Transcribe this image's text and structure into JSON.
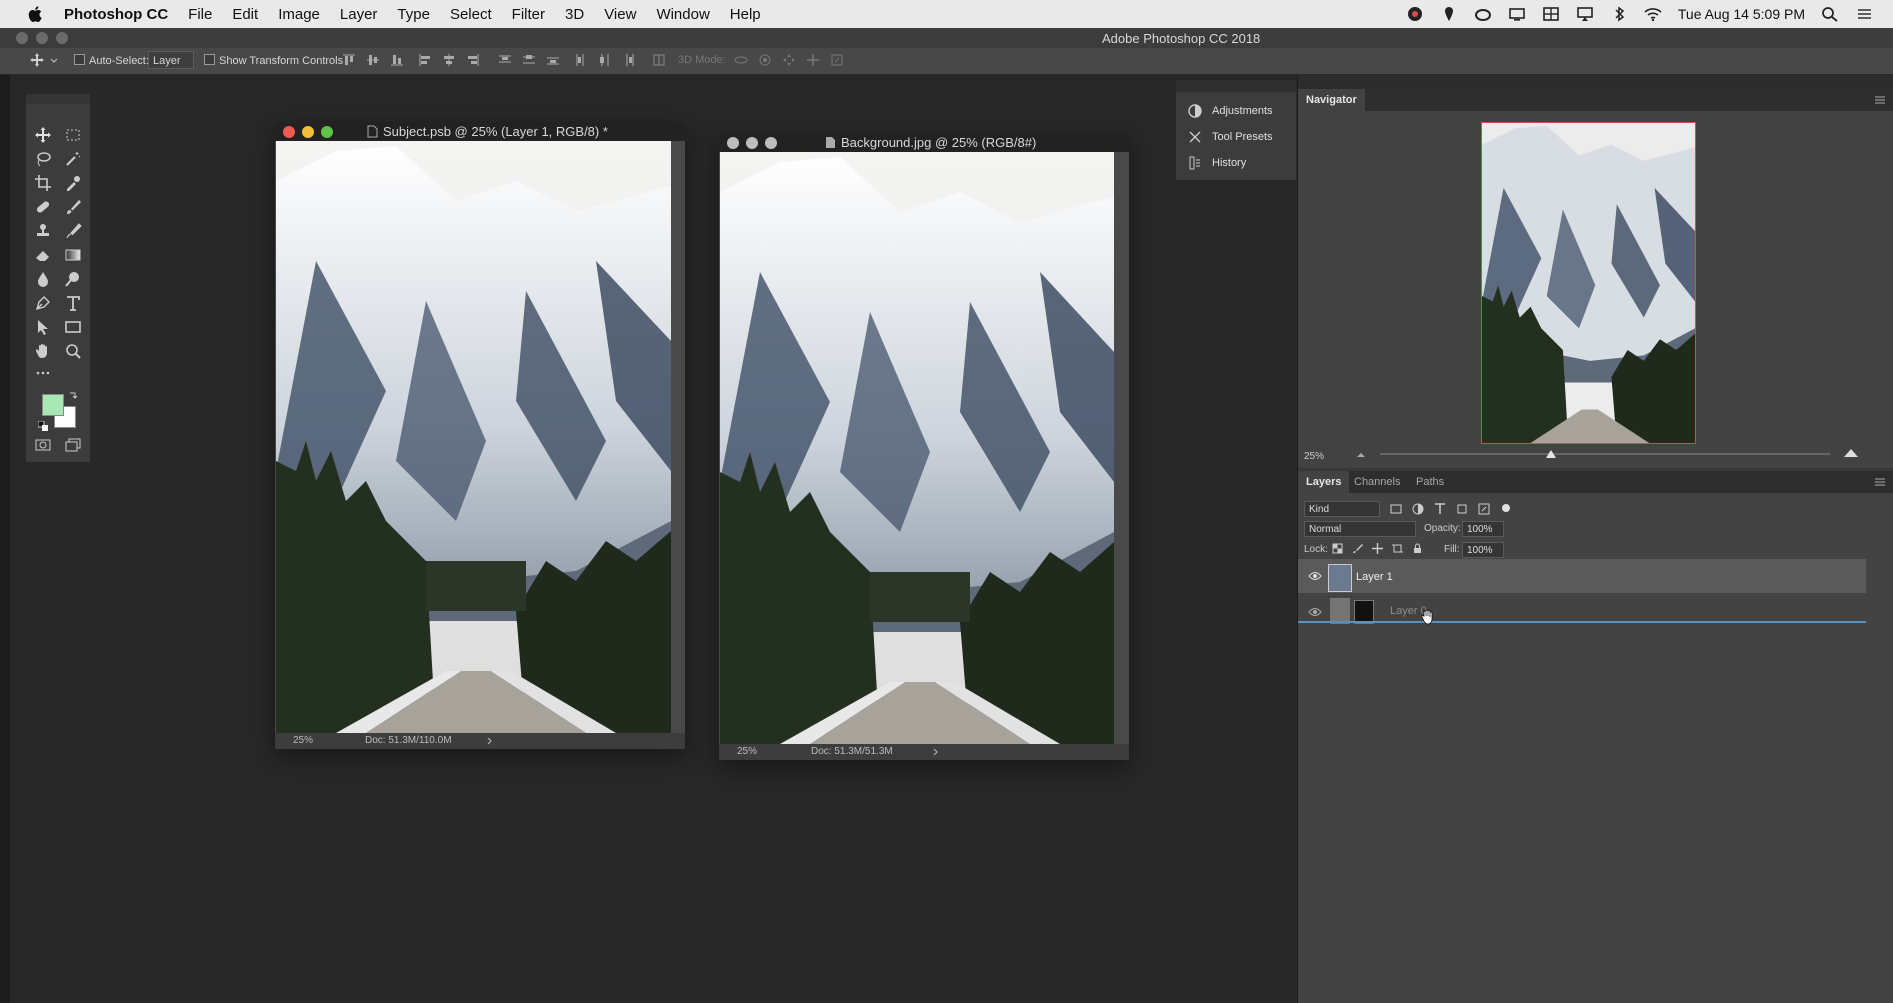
{
  "menubar": {
    "app_name": "Photoshop CC",
    "items": [
      "File",
      "Edit",
      "Image",
      "Layer",
      "Type",
      "Select",
      "Filter",
      "3D",
      "View",
      "Window",
      "Help"
    ],
    "clock": "Tue Aug 14  5:09 PM"
  },
  "app_title": "Adobe Photoshop CC 2018",
  "options_bar": {
    "auto_select_label": "Auto-Select:",
    "auto_select_value": "Layer",
    "show_transform_label": "Show Transform Controls",
    "mode_3d_label": "3D Mode:"
  },
  "documents": [
    {
      "title": "Subject.psb @ 25% (Layer 1, RGB/8) *",
      "zoom": "25%",
      "doc_info": "Doc: 51.3M/110.0M"
    },
    {
      "title": "Background.jpg @ 25% (RGB/8#)",
      "zoom": "25%",
      "doc_info": "Doc: 51.3M/51.3M"
    }
  ],
  "collapsed_panels": [
    "Adjustments",
    "Tool Presets",
    "History"
  ],
  "navigator": {
    "tab": "Navigator",
    "zoom": "25%",
    "zoom_slider_fraction": 0.38
  },
  "layers_panel": {
    "tabs": [
      "Layers",
      "Channels",
      "Paths"
    ],
    "filter_kind": "Kind",
    "blend_mode": "Normal",
    "opacity_label": "Opacity:",
    "opacity_value": "100%",
    "lock_label": "Lock:",
    "fill_label": "Fill:",
    "fill_value": "100%",
    "layers": [
      {
        "name": "Layer 1"
      },
      {
        "name": "Layer 0"
      }
    ]
  },
  "colors": {
    "foreground": "#a8e8b4",
    "background": "#ffffff",
    "accent_line": "#5a8fc2"
  }
}
